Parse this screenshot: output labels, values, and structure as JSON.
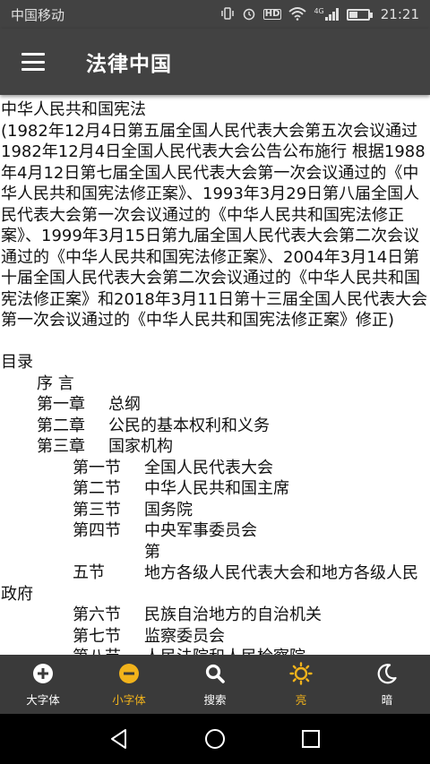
{
  "status_bar": {
    "carrier": "中国移动",
    "time": "21:21",
    "network": "4G",
    "hd_label": "HD",
    "battery_level": 0.4,
    "icons": [
      "vibrate-icon",
      "alarm-icon",
      "hd-icon",
      "wifi-icon",
      "signal-icon",
      "battery-icon"
    ]
  },
  "app_bar": {
    "title": "法律中国",
    "menu_icon": "hamburger-menu-icon",
    "background": "#424242"
  },
  "document": {
    "title": "中华人民共和国宪法",
    "preamble": "(1982年12月4日第五届全国人民代表大会第五次会议通过 1982年12月4日全国人民代表大会公告公布施行 根据1988年4月12日第七届全国人民代表大会第一次会议通过的《中华人民共和国宪法修正案》、1993年3月29日第八届全国人民代表大会第一次会议通过的《中华人民共和国宪法修正案》、1999年3月15日第九届全国人民代表大会第二次会议通过的《中华人民共和国宪法修正案》、2004年3月14日第十届全国人民代表大会第二次会议通过的《中华人民共和国宪法修正案》和2018年3月11日第十三届全国人民代表大会第一次会议通过的《中华人民共和国宪法修正案》修正)",
    "toc_heading": "目录",
    "toc": [
      {
        "level": 1,
        "label": "序 言",
        "title": ""
      },
      {
        "level": 1,
        "label": "第一章",
        "title": "总纲"
      },
      {
        "level": 1,
        "label": "第二章",
        "title": "公民的基本权利和义务"
      },
      {
        "level": 1,
        "label": "第三章",
        "title": "国家机构"
      },
      {
        "level": 2,
        "label": "第一节",
        "title": "全国人民代表大会"
      },
      {
        "level": 2,
        "label": "第二节",
        "title": "中华人民共和国主席"
      },
      {
        "level": 2,
        "label": "第三节",
        "title": "国务院"
      },
      {
        "level": 2,
        "label": "第四节",
        "title": "中央军事委员会"
      },
      {
        "level": 2,
        "label": "第五节",
        "title": "地方各级人民代表大会和地方各级人民政府"
      },
      {
        "level": 2,
        "label": "第六节",
        "title": "民族自治地方的自治机关"
      },
      {
        "level": 2,
        "label": "第七节",
        "title": "监察委员会"
      },
      {
        "level": 2,
        "label": "第八节",
        "title": "人民法院和人民检察院"
      }
    ]
  },
  "bottom_nav": {
    "items": [
      {
        "label": "大字体",
        "icon": "plus-circle-icon",
        "color": "#ffffff"
      },
      {
        "label": "小字体",
        "icon": "minus-circle-icon",
        "color": "#f2b31b"
      },
      {
        "label": "搜索",
        "icon": "search-icon",
        "color": "#ffffff"
      },
      {
        "label": "亮",
        "icon": "sun-icon",
        "color": "#f2b31b"
      },
      {
        "label": "暗",
        "icon": "moon-icon",
        "color": "#ffffff"
      }
    ]
  },
  "system_nav": {
    "icons": [
      "back-icon",
      "home-icon",
      "recents-icon"
    ]
  }
}
